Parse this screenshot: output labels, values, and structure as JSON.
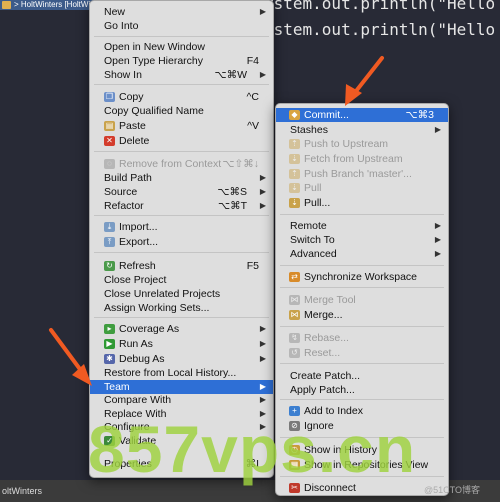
{
  "window_title": "> HoltWinters [HoltWinters",
  "code_line_1": "ystem.out.println(\"Hello wo",
  "code_line_2": "ystem.out.println(\"Hello 苹",
  "statusbar": {
    "text": "oltWinters"
  },
  "main_menu": {
    "items": [
      {
        "label": "New",
        "shortcut": "",
        "arrow": true,
        "enabled": true,
        "icon": ""
      },
      {
        "label": "Go Into",
        "shortcut": "",
        "arrow": false,
        "enabled": true,
        "icon": ""
      },
      {
        "label": "Open in New Window",
        "shortcut": "",
        "arrow": false,
        "enabled": true,
        "icon": ""
      },
      {
        "label": "Open Type Hierarchy",
        "shortcut": "F4",
        "arrow": false,
        "enabled": true,
        "icon": ""
      },
      {
        "label": "Show In",
        "shortcut": "⌥⌘W",
        "arrow": true,
        "enabled": true,
        "icon": ""
      },
      {
        "label": "Copy",
        "shortcut": "^C",
        "arrow": false,
        "enabled": true,
        "icon": "copy-icon"
      },
      {
        "label": "Copy Qualified Name",
        "shortcut": "",
        "arrow": false,
        "enabled": true,
        "icon": ""
      },
      {
        "label": "Paste",
        "shortcut": "^V",
        "arrow": false,
        "enabled": true,
        "icon": "paste-icon"
      },
      {
        "label": "Delete",
        "shortcut": "",
        "arrow": false,
        "enabled": true,
        "icon": "delete-icon"
      },
      {
        "label": "Remove from Context",
        "shortcut": "⌥⇧⌘↓",
        "arrow": false,
        "enabled": false,
        "icon": "remove-context-icon"
      },
      {
        "label": "Build Path",
        "shortcut": "",
        "arrow": true,
        "enabled": true,
        "icon": ""
      },
      {
        "label": "Source",
        "shortcut": "⌥⌘S",
        "arrow": true,
        "enabled": true,
        "icon": ""
      },
      {
        "label": "Refactor",
        "shortcut": "⌥⌘T",
        "arrow": true,
        "enabled": true,
        "icon": ""
      },
      {
        "label": "Import...",
        "shortcut": "",
        "arrow": false,
        "enabled": true,
        "icon": "import-icon"
      },
      {
        "label": "Export...",
        "shortcut": "",
        "arrow": false,
        "enabled": true,
        "icon": "export-icon"
      },
      {
        "label": "Refresh",
        "shortcut": "F5",
        "arrow": false,
        "enabled": true,
        "icon": "refresh-icon"
      },
      {
        "label": "Close Project",
        "shortcut": "",
        "arrow": false,
        "enabled": true,
        "icon": ""
      },
      {
        "label": "Close Unrelated Projects",
        "shortcut": "",
        "arrow": false,
        "enabled": true,
        "icon": ""
      },
      {
        "label": "Assign Working Sets...",
        "shortcut": "",
        "arrow": false,
        "enabled": true,
        "icon": ""
      },
      {
        "label": "Coverage As",
        "shortcut": "",
        "arrow": true,
        "enabled": true,
        "icon": "coverage-icon"
      },
      {
        "label": "Run As",
        "shortcut": "",
        "arrow": true,
        "enabled": true,
        "icon": "run-icon"
      },
      {
        "label": "Debug As",
        "shortcut": "",
        "arrow": true,
        "enabled": true,
        "icon": "debug-icon"
      },
      {
        "label": "Restore from Local History...",
        "shortcut": "",
        "arrow": false,
        "enabled": true,
        "icon": ""
      },
      {
        "label": "Team",
        "shortcut": "",
        "arrow": true,
        "enabled": true,
        "icon": "",
        "selected": true
      },
      {
        "label": "Compare With",
        "shortcut": "",
        "arrow": true,
        "enabled": true,
        "icon": ""
      },
      {
        "label": "Replace With",
        "shortcut": "",
        "arrow": true,
        "enabled": true,
        "icon": ""
      },
      {
        "label": "Configure",
        "shortcut": "",
        "arrow": true,
        "enabled": true,
        "icon": ""
      },
      {
        "label": "Validate",
        "shortcut": "",
        "arrow": false,
        "enabled": true,
        "icon": "validate-icon"
      },
      {
        "label": "Properties",
        "shortcut": "⌘I",
        "arrow": false,
        "enabled": true,
        "icon": ""
      }
    ]
  },
  "team_menu": {
    "items": [
      {
        "label": "Commit...",
        "shortcut": "⌥⌘3",
        "arrow": false,
        "enabled": true,
        "icon": "commit-icon",
        "selected": true
      },
      {
        "label": "Stashes",
        "shortcut": "",
        "arrow": true,
        "enabled": true,
        "icon": ""
      },
      {
        "label": "Push to Upstream",
        "shortcut": "",
        "arrow": false,
        "enabled": false,
        "icon": "push-upstream-icon"
      },
      {
        "label": "Fetch from Upstream",
        "shortcut": "",
        "arrow": false,
        "enabled": false,
        "icon": "fetch-upstream-icon"
      },
      {
        "label": "Push Branch 'master'...",
        "shortcut": "",
        "arrow": false,
        "enabled": false,
        "icon": "push-branch-icon"
      },
      {
        "label": "Pull",
        "shortcut": "",
        "arrow": false,
        "enabled": false,
        "icon": "pull-icon"
      },
      {
        "label": "Pull...",
        "shortcut": "",
        "arrow": false,
        "enabled": true,
        "icon": "pull-dialog-icon"
      },
      {
        "label": "Remote",
        "shortcut": "",
        "arrow": true,
        "enabled": true,
        "icon": ""
      },
      {
        "label": "Switch To",
        "shortcut": "",
        "arrow": true,
        "enabled": true,
        "icon": ""
      },
      {
        "label": "Advanced",
        "shortcut": "",
        "arrow": true,
        "enabled": true,
        "icon": ""
      },
      {
        "label": "Synchronize Workspace",
        "shortcut": "",
        "arrow": false,
        "enabled": true,
        "icon": "synchronize-icon"
      },
      {
        "label": "Merge Tool",
        "shortcut": "",
        "arrow": false,
        "enabled": false,
        "icon": "merge-tool-icon"
      },
      {
        "label": "Merge...",
        "shortcut": "",
        "arrow": false,
        "enabled": true,
        "icon": "merge-icon"
      },
      {
        "label": "Rebase...",
        "shortcut": "",
        "arrow": false,
        "enabled": false,
        "icon": "rebase-icon"
      },
      {
        "label": "Reset...",
        "shortcut": "",
        "arrow": false,
        "enabled": false,
        "icon": "reset-icon"
      },
      {
        "label": "Create Patch...",
        "shortcut": "",
        "arrow": false,
        "enabled": true,
        "icon": ""
      },
      {
        "label": "Apply Patch...",
        "shortcut": "",
        "arrow": false,
        "enabled": true,
        "icon": ""
      },
      {
        "label": "Add to Index",
        "shortcut": "",
        "arrow": false,
        "enabled": true,
        "icon": "add-index-icon"
      },
      {
        "label": "Ignore",
        "shortcut": "",
        "arrow": false,
        "enabled": true,
        "icon": "ignore-icon"
      },
      {
        "label": "Show in History",
        "shortcut": "",
        "arrow": false,
        "enabled": true,
        "icon": "history-icon"
      },
      {
        "label": "Show in Repositories View",
        "shortcut": "",
        "arrow": false,
        "enabled": true,
        "icon": "repositories-icon"
      },
      {
        "label": "Disconnect",
        "shortcut": "",
        "arrow": false,
        "enabled": true,
        "icon": "disconnect-icon"
      }
    ]
  },
  "watermark": {
    "text": "857vps.cn",
    "credit": "@51CTO博客"
  },
  "colors": {
    "selection": "#2e6fd6",
    "menu_bg": "#dedede",
    "annotation_arrow": "#f05a22",
    "watermark": "#9fd23f"
  }
}
